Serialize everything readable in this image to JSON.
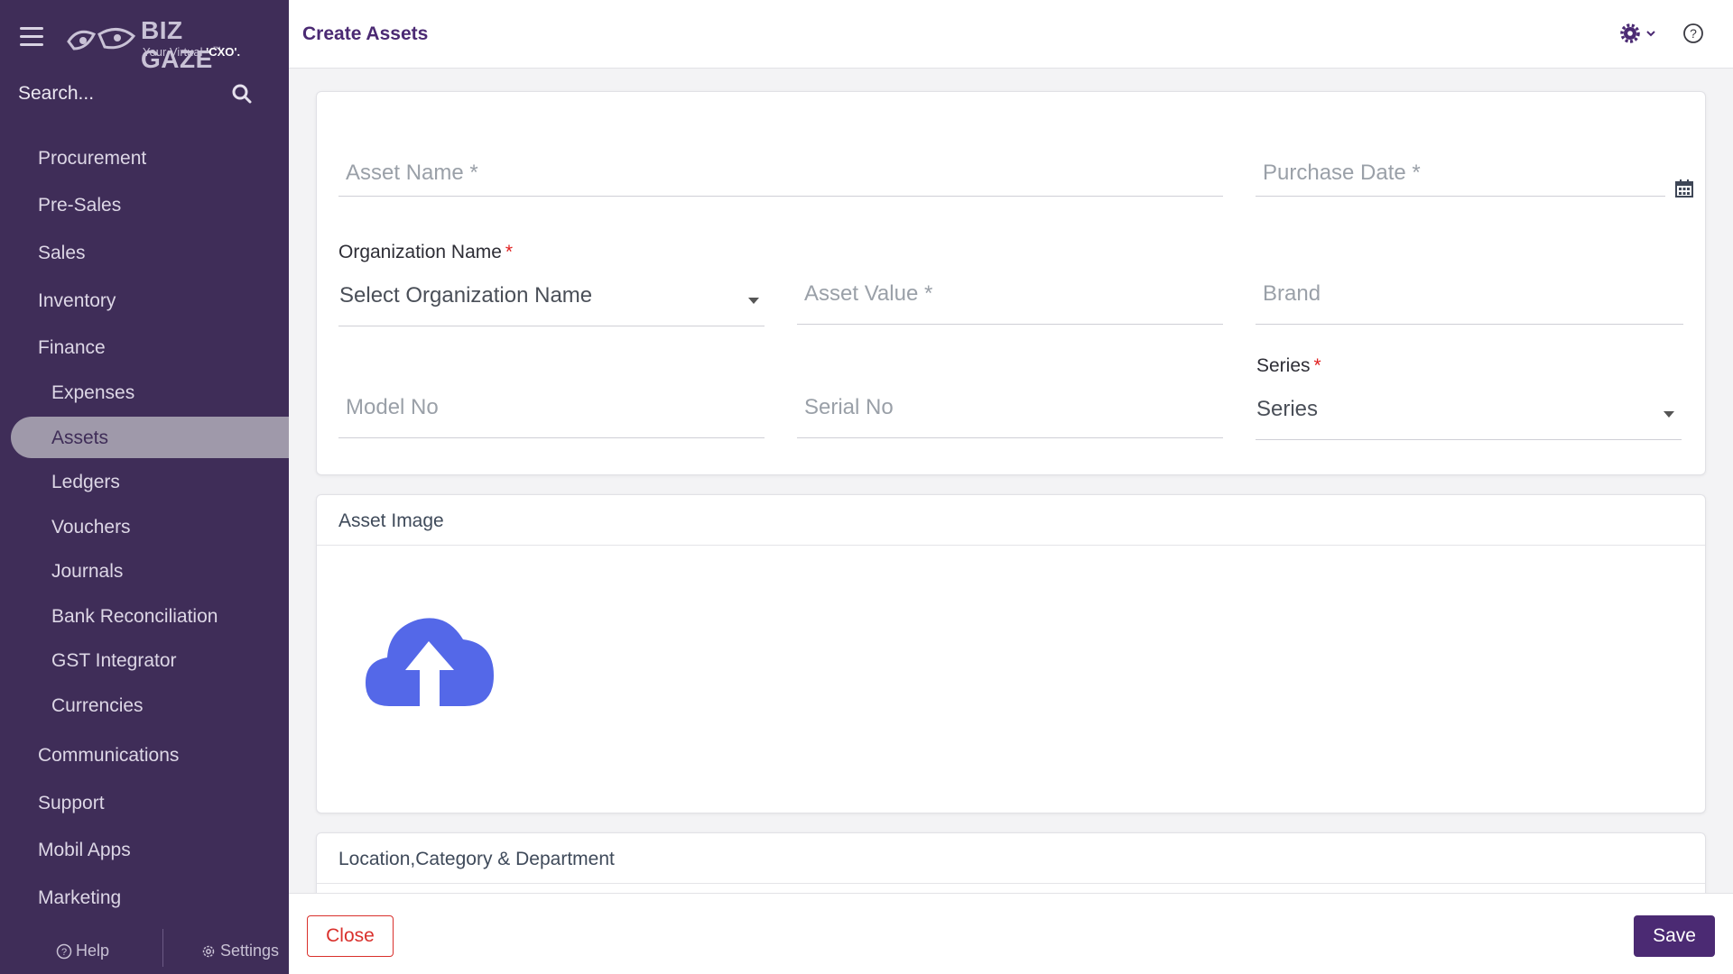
{
  "brand": {
    "name": "BIZ GAZE",
    "trademark": "™",
    "tagline_prefix": "Your Virtual ",
    "tagline_emphasis": "'CXO'."
  },
  "search": {
    "placeholder": "Search..."
  },
  "sidebar": {
    "items": [
      {
        "label": "Procurement",
        "level": "top"
      },
      {
        "label": "Pre-Sales",
        "level": "top"
      },
      {
        "label": "Sales",
        "level": "top"
      },
      {
        "label": "Inventory",
        "level": "top"
      },
      {
        "label": "Finance",
        "level": "top"
      },
      {
        "label": "Expenses",
        "level": "sub"
      },
      {
        "label": "Assets",
        "level": "sub",
        "active": true
      },
      {
        "label": "Ledgers",
        "level": "sub"
      },
      {
        "label": "Vouchers",
        "level": "sub"
      },
      {
        "label": "Journals",
        "level": "sub"
      },
      {
        "label": "Bank Reconciliation",
        "level": "sub"
      },
      {
        "label": "GST Integrator",
        "level": "sub"
      },
      {
        "label": "Currencies",
        "level": "sub"
      },
      {
        "label": "Communications",
        "level": "top"
      },
      {
        "label": "Support",
        "level": "top"
      },
      {
        "label": "Mobil Apps",
        "level": "top"
      },
      {
        "label": "Marketing",
        "level": "top"
      }
    ],
    "footer": {
      "help": "Help",
      "settings": "Settings"
    }
  },
  "header": {
    "title": "Create Assets"
  },
  "form": {
    "asset_name": {
      "placeholder": "Asset Name *"
    },
    "purchase_date": {
      "placeholder": "Purchase Date *"
    },
    "organization": {
      "label": "Organization Name",
      "required_mark": "*",
      "placeholder": "Select Organization Name"
    },
    "asset_value": {
      "placeholder": "Asset Value *"
    },
    "brand": {
      "placeholder": "Brand"
    },
    "model_no": {
      "placeholder": "Model No"
    },
    "serial_no": {
      "placeholder": "Serial No"
    },
    "series": {
      "label": "Series",
      "required_mark": "*",
      "placeholder": "Series"
    }
  },
  "sections": {
    "asset_image": "Asset Image",
    "location": "Location,Category & Department"
  },
  "actions": {
    "close": "Close",
    "save": "Save"
  },
  "colors": {
    "sidebar_bg": "#3f2d58",
    "accent": "#4b2a73",
    "upload_icon": "#5468e8",
    "danger": "#d9302c"
  }
}
